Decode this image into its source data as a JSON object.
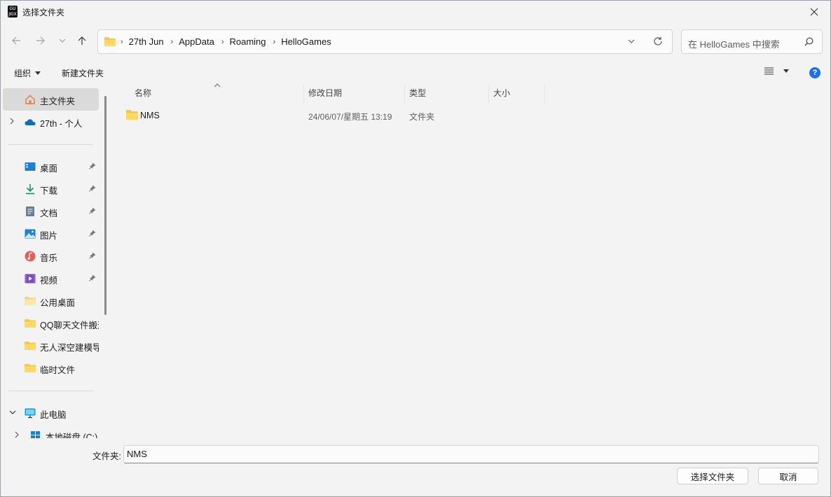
{
  "window": {
    "title": "选择文件夹",
    "app_icon_text": "GU JKIX"
  },
  "address": {
    "crumbs": [
      "27th Jun",
      "AppData",
      "Roaming",
      "HelloGames"
    ]
  },
  "search": {
    "placeholder": "在 HelloGames 中搜索"
  },
  "toolbar": {
    "organize_label": "组织",
    "new_folder_label": "新建文件夹",
    "help_label": "?"
  },
  "nav_pane": {
    "home": "主文件夹",
    "onedrive": "27th - 个人",
    "quick": [
      "桌面",
      "下载",
      "文档",
      "图片",
      "音乐",
      "视频",
      "公用桌面",
      "QQ聊天文件搬运",
      "无人深空建模导",
      "临时文件"
    ],
    "this_pc": "此电脑",
    "drive_c": "本地磁盘 (C:)"
  },
  "file_list": {
    "columns": {
      "name": "名称",
      "date": "修改日期",
      "type": "类型",
      "size": "大小"
    },
    "rows": [
      {
        "name": "NMS",
        "date": "24/06/07/星期五 13:19",
        "type": "文件夹"
      }
    ]
  },
  "footer": {
    "folder_label": "文件夹:",
    "folder_value": "NMS",
    "select_button": "选择文件夹",
    "cancel_button": "取消"
  },
  "colors": {
    "accent": "#1a73e8",
    "folder_yellow": "#f5c84c",
    "background": "#f3f3f3"
  }
}
